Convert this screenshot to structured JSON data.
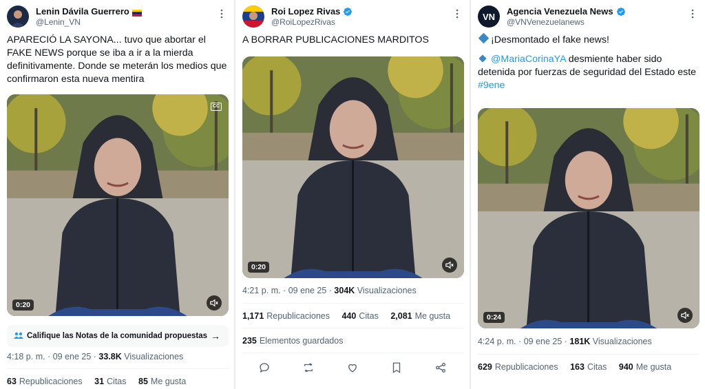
{
  "tweets": [
    {
      "name": "Lenin Dávila Guerrero",
      "handle": "@Lenin_VN",
      "text": "APARECIÓ LA SAYONA... tuvo que abortar el FAKE NEWS porque se iba a ir a la mierda definitivamente. Donde se meterán los medios que confirmaron esta nueva mentira",
      "duration": "0:20",
      "notes_label": "Califique las Notas de la comunidad propuestas",
      "time": "4:18 p. m. · 09 ene 25 · ",
      "views_count": "33.8K",
      "views_label": "Visualizaciones",
      "reposts_count": "63",
      "reposts_label": "Republicaciones",
      "quotes_count": "31",
      "quotes_label": "Citas",
      "likes_count": "85",
      "likes_label": "Me gusta"
    },
    {
      "name": "Roi Lopez Rivas",
      "handle": "@RoiLopezRivas",
      "text": "A BORRAR PUBLICACIONES MARDITOS",
      "duration": "0:20",
      "time": "4:21 p. m. · 09 ene 25 · ",
      "views_count": "304K",
      "views_label": "Visualizaciones",
      "reposts_count": "1,171",
      "reposts_label": "Republicaciones",
      "quotes_count": "440",
      "quotes_label": "Citas",
      "likes_count": "2,081",
      "likes_label": "Me gusta",
      "saved_count": "235",
      "saved_label": "Elementos guardados"
    },
    {
      "name": "Agencia Venezuela News",
      "handle": "@VNVenezuelanews",
      "line1": "¡Desmontado el fake news!",
      "mention": "@MariaCorinaYA",
      "text_rest": " desmiente haber sido detenida por fuerzas de seguridad del Estado este ",
      "hashtag": "#9ene",
      "duration": "0:24",
      "time": "4:24 p. m. · 09 ene 25 · ",
      "views_count": "181K",
      "views_label": "Visualizaciones",
      "reposts_count": "629",
      "reposts_label": "Republicaciones",
      "quotes_count": "163",
      "quotes_label": "Citas",
      "likes_count": "940",
      "likes_label": "Me gusta"
    }
  ],
  "icons": [
    "verified-badge-icon",
    "more-icon",
    "mute-icon",
    "captions-icon",
    "reply-icon",
    "repost-icon",
    "like-icon",
    "bookmark-icon",
    "share-icon",
    "community-notes-icon",
    "arrow-right-icon"
  ],
  "colors": {
    "link": "#1d9bf0",
    "secondary_text": "#536471",
    "verified": "#1d9bf0"
  }
}
